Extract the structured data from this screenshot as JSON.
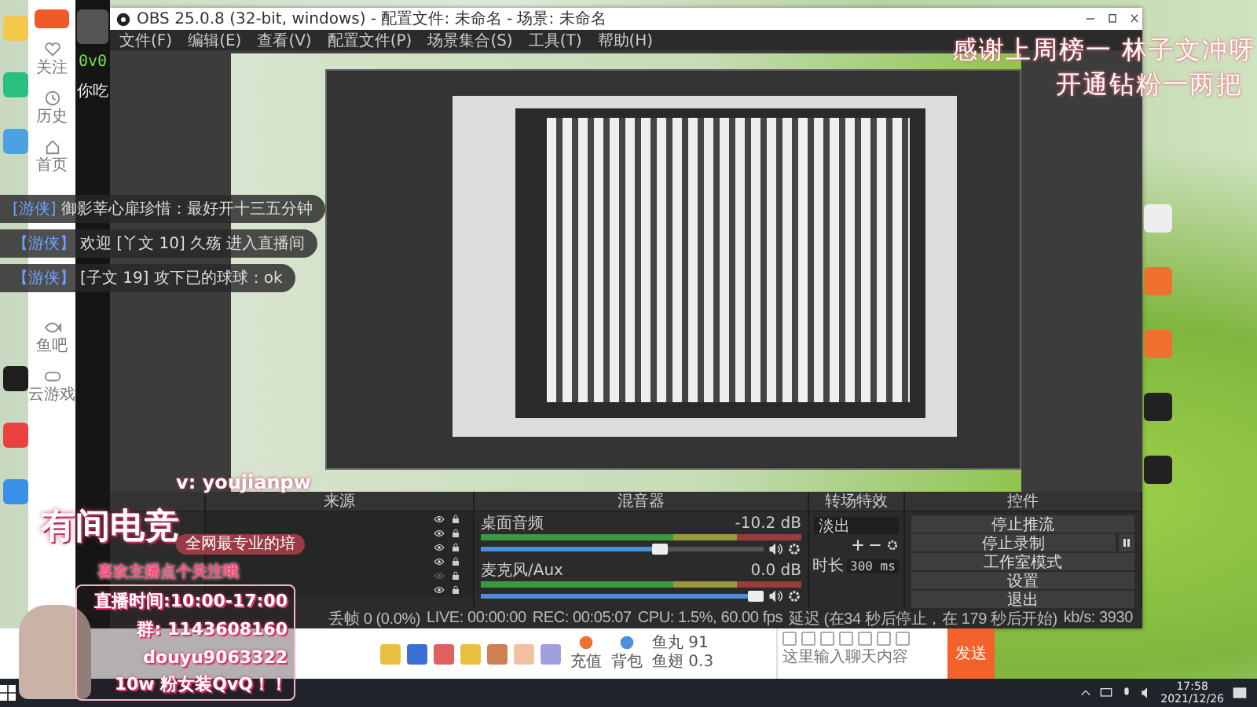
{
  "douyu": {
    "nav": [
      "关注",
      "历史",
      "首页",
      "鱼吧",
      "云游戏"
    ],
    "card": [
      "0v0",
      "你吃"
    ],
    "chat": [
      {
        "badge": "[游侠]",
        "text": "御影莘心扉珍惜：最好开十三五分钟"
      },
      {
        "badge": "【游侠】",
        "text": "欢迎 [丫文 10] 久殇 进入直播间"
      },
      {
        "badge": "【游侠】",
        "text": "[子文 19] 攻下已的球球：ok"
      }
    ],
    "bottom": {
      "recharge": "充值",
      "backpack": "背包",
      "balances": [
        "鱼丸 91",
        "鱼翅 0.3"
      ],
      "placeholder": "这里输入聊天内容",
      "send": "发送"
    }
  },
  "obs": {
    "title": "OBS 25.0.8 (32-bit, windows) - 配置文件: 未命名 - 场景: 未命名",
    "menu": [
      "文件(F)",
      "编辑(E)",
      "查看(V)",
      "配置文件(P)",
      "场景集合(S)",
      "工具(T)",
      "帮助(H)"
    ],
    "sources": {
      "title": "来源",
      "items": [
        {
          "visible": true
        },
        {
          "visible": true
        },
        {
          "visible": true
        },
        {
          "visible": true
        },
        {
          "visible": false
        },
        {
          "visible": true
        }
      ]
    },
    "mixer": {
      "title": "混音器",
      "channels": [
        {
          "name": "桌面音频",
          "reading": "-10.2 dB",
          "level": 0.66
        },
        {
          "name": "麦克风/Aux",
          "reading": "0.0 dB",
          "level": 1.0
        }
      ]
    },
    "transitions": {
      "title": "转场特效",
      "transition": "淡出",
      "duration_label": "时长",
      "duration": "300 ms"
    },
    "controls": {
      "title": "控件",
      "buttons": [
        {
          "label": "停止推流",
          "kind": "menu"
        },
        {
          "label": "停止录制",
          "kind": "pause"
        },
        {
          "label": "工作室模式",
          "kind": "plain"
        },
        {
          "label": "设置",
          "kind": "plain"
        },
        {
          "label": "退出",
          "kind": "plain"
        }
      ]
    },
    "status": [
      "丢帧 0 (0.0%)",
      "LIVE: 00:00:00",
      "REC: 00:05:07",
      "CPU: 1.5%, 60.00 fps",
      "延迟 (在34 秒后停止，在 179 秒后开始)",
      "kb/s: 3930"
    ]
  },
  "overlay": {
    "marquee": [
      "感谢上周榜一 林子文冲呀",
      "开通钻粉一两把"
    ],
    "brand": "有间电竞",
    "wechat": "v: youjianpw",
    "slogan": "全网最专业的培",
    "follow": "喜欢主播点个关注哦",
    "lines": [
      "直播时间:10:00-17:00",
      "群: 1143608160",
      "douyu9063322",
      "10w 粉女装QvQ！！"
    ]
  },
  "taskbar": {
    "time": "17:58",
    "date": "2021/12/26"
  }
}
